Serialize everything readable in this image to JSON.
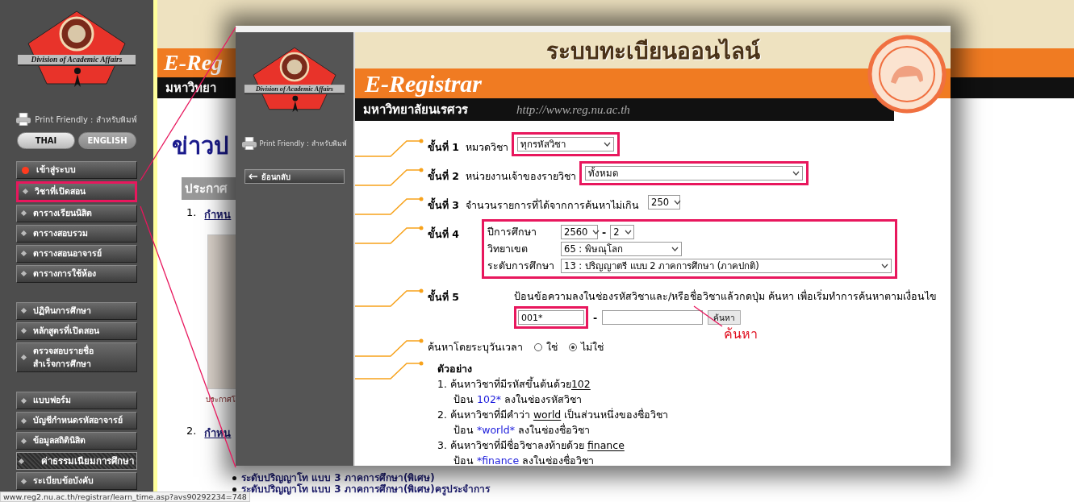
{
  "sidebar": {
    "logo_caption": "Division of Academic Affairs",
    "print_friendly": "Print Friendly : สำหรับพิมพ์",
    "languages": [
      {
        "label": "THAI",
        "selected": true
      },
      {
        "label": "ENGLISH",
        "selected": false
      }
    ],
    "menu_groups": [
      {
        "items": [
          {
            "label": "เข้าสู่ระบบ",
            "kind": "login",
            "highlighted": false,
            "selected": false
          },
          {
            "label": "วิชาที่เปิดสอน",
            "kind": "link",
            "highlighted": true,
            "selected": false
          },
          {
            "label": "ตารางเรียนนิสิต",
            "kind": "link",
            "highlighted": false,
            "selected": false
          },
          {
            "label": "ตารางสอบรวม",
            "kind": "link",
            "highlighted": false,
            "selected": false
          },
          {
            "label": "ตารางสอนอาจารย์",
            "kind": "link",
            "highlighted": false,
            "selected": false
          },
          {
            "label": "ตารางการใช้ห้อง",
            "kind": "link",
            "highlighted": false,
            "selected": false
          }
        ]
      },
      {
        "items": [
          {
            "label": "ปฏิทินการศึกษา",
            "kind": "link",
            "highlighted": false,
            "selected": false
          },
          {
            "label": "หลักสูตรที่เปิดสอน",
            "kind": "link",
            "highlighted": false,
            "selected": false
          },
          {
            "label": "ตรวจสอบรายชื่อ\nสำเร็จการศึกษา",
            "kind": "link",
            "highlighted": false,
            "selected": false
          }
        ]
      },
      {
        "items": [
          {
            "label": "แบบฟอร์ม",
            "kind": "link",
            "highlighted": false,
            "selected": false
          },
          {
            "label": "บัญชีกำหนดรหัสอาจารย์",
            "kind": "link",
            "highlighted": false,
            "selected": false
          },
          {
            "label": "ข้อมูลสถิตินิสิต",
            "kind": "link",
            "highlighted": false,
            "selected": false
          },
          {
            "label": "ค่าธรรมเนียมการศึกษา",
            "kind": "link",
            "highlighted": false,
            "selected": true
          },
          {
            "label": "ระเบียบข้อบังคับ",
            "kind": "link",
            "highlighted": false,
            "selected": false
          }
        ]
      }
    ]
  },
  "background_page": {
    "banner_brand": "E-Reg",
    "banner_university": "มหาวิทยา",
    "headline": "ข่าวป",
    "section_title": "ประกาศ",
    "items": [
      {
        "number": "1.",
        "title": "กำหน"
      },
      {
        "number": "2.",
        "title": "กำหน"
      }
    ],
    "caption": "ประกาศโ",
    "bullets": [
      "ระดับปริญญาโท แบบ 3 ภาคการศึกษา(พิเศษ)",
      "ระดับปริญญาโท แบบ 3 ภาคการศึกษา(พิเศษ)ครูประจำการ"
    ]
  },
  "status_bar": {
    "url": "www.reg2.nu.ac.th/registrar/learn_time.asp?avs90292234=748"
  },
  "window": {
    "sidebar": {
      "logo_caption": "Division of Academic Affairs",
      "print_friendly": "Print Friendly : สำหรับพิมพ์",
      "back_button": "ย้อนกลับ"
    },
    "banner": {
      "title": "ระบบทะเบียนออนไลน์",
      "brand": "E-Registrar",
      "university": "มหาวิทยาลัยนเรศวร",
      "url": "http://www.reg.nu.ac.th"
    },
    "steps": [
      {
        "kind": "select",
        "label": "ขั้นที่ 1",
        "text": "หมวดวิชา",
        "value": "ทุกรหัสวิชา",
        "highlighted": true
      },
      {
        "kind": "select",
        "label": "ขั้นที่ 2",
        "text": "หน่วยงานเจ้าของรายวิชา",
        "value": "ทั้งหมด",
        "highlighted": true
      },
      {
        "kind": "select",
        "label": "ขั้นที่ 3",
        "text": "จำนวนรายการที่ได้จากการค้นหาไม่เกิน",
        "value": "250",
        "highlighted": false
      },
      {
        "kind": "fields",
        "label": "ขั้นที่ 4",
        "highlighted": true,
        "fields": [
          {
            "label": "ปีการศึกษา",
            "selects": [
              "2560",
              "2"
            ],
            "separator": "-"
          },
          {
            "label": "วิทยาเขต",
            "selects": [
              "65 : พิษณุโลก"
            ]
          },
          {
            "label": "ระดับการศึกษา",
            "selects": [
              "13 : ปริญญาตรี แบบ 2 ภาคการศึกษา (ภาคปกติ)"
            ]
          }
        ]
      },
      {
        "kind": "search",
        "label": "ขั้นที่ 5",
        "instruction": "ป้อนข้อความลงในช่องรหัสวิชาและ/หรือชื่อวิชาแล้วกดปุ่ม ค้นหา เพื่อเริ่มทำการค้นหาตามเงื่อนไข",
        "code_value": "001*",
        "separator": "-",
        "button": "ค้นหา",
        "highlighted": true
      }
    ],
    "date_search": {
      "label": "ค้นหาโดยระบุวันเวลา",
      "options": [
        {
          "label": "ใช่",
          "selected": false
        },
        {
          "label": "ไม่ใช่",
          "selected": true
        }
      ]
    },
    "examples": {
      "title": "ตัวอย่าง",
      "items": [
        {
          "before": "1. ค้นหาวิชาที่มีรหัสขึ้นต้นด้วย",
          "keyword": "102",
          "hint_before": "ป้อน ",
          "hint_value": "102*",
          "hint_after": " ลงในช่องรหัสวิชา"
        },
        {
          "before": "2. ค้นหาวิชาที่มีคำว่า ",
          "keyword": "world",
          "after": " เป็นส่วนหนึ่งของชื่อวิชา",
          "hint_before": "ป้อน ",
          "hint_value": "*world*",
          "hint_after": " ลงในช่องชื่อวิชา"
        },
        {
          "before": "3. ค้นหาวิชาที่มีชื่อวิชาลงท้ายด้วย ",
          "keyword": "finance",
          "hint_before": "ป้อน ",
          "hint_value": "*finance",
          "hint_after": " ลงในช่องชื่อวิชา"
        }
      ]
    },
    "annotation": "ค้นหา"
  }
}
